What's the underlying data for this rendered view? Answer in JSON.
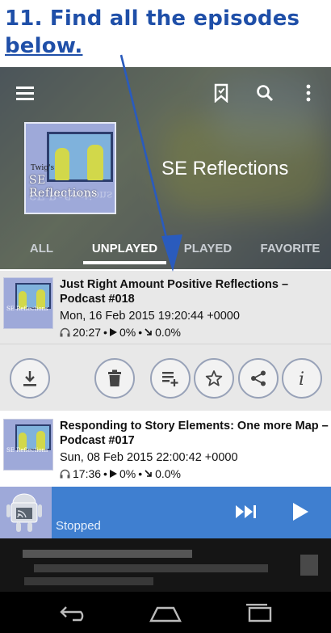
{
  "caption": {
    "line1": "11. Find all the episodes",
    "line2": "below."
  },
  "toolbar": {
    "menu_icon": "hamburger-menu-icon",
    "bookmark_icon": "bookmark-icon",
    "search_icon": "search-icon",
    "overflow_icon": "more-vert-icon"
  },
  "podcast": {
    "title": "SE Reflections",
    "artwork_text_small": "Twig's",
    "artwork_text_big": "SE Reflections"
  },
  "tabs": [
    {
      "label": "ALL",
      "active": false
    },
    {
      "label": "UNPLAYED",
      "active": true
    },
    {
      "label": "PLAYED",
      "active": false
    },
    {
      "label": "FAVORITE",
      "active": false
    }
  ],
  "episodes": [
    {
      "title": "Just Right Amount Positive Reflections – Podcast #018",
      "date": "Mon, 16 Feb 2015 19:20:44 +0000",
      "duration": "20:27",
      "progress": "0%",
      "download": "0.0%",
      "thumb_text": "SE Reflections"
    },
    {
      "title": "Responding to Story Elements: One more Map – Podcast #017",
      "date": "Sun, 08 Feb 2015 22:00:42 +0000",
      "duration": "17:36",
      "progress": "0%",
      "download": "0.0%",
      "thumb_text": "SE Reflections"
    }
  ],
  "actions": [
    {
      "name": "download-button",
      "icon": "download-icon"
    },
    {
      "name": "delete-button",
      "icon": "trash-icon"
    },
    {
      "name": "add-to-playlist-button",
      "icon": "playlist-add-icon"
    },
    {
      "name": "favorite-button",
      "icon": "star-icon"
    },
    {
      "name": "share-button",
      "icon": "share-icon"
    },
    {
      "name": "info-button",
      "icon": "info-icon"
    }
  ],
  "player": {
    "status": "Stopped",
    "skip_icon": "skip-next-icon",
    "play_icon": "play-icon"
  },
  "navbar": {
    "back_icon": "back-icon",
    "home_icon": "home-icon",
    "recents_icon": "recents-icon"
  },
  "colors": {
    "caption": "#1f4fa8",
    "player_bar": "#3f7fd0",
    "episode_selected_bg": "#e8e8e8",
    "button_border": "#98a2b8"
  }
}
